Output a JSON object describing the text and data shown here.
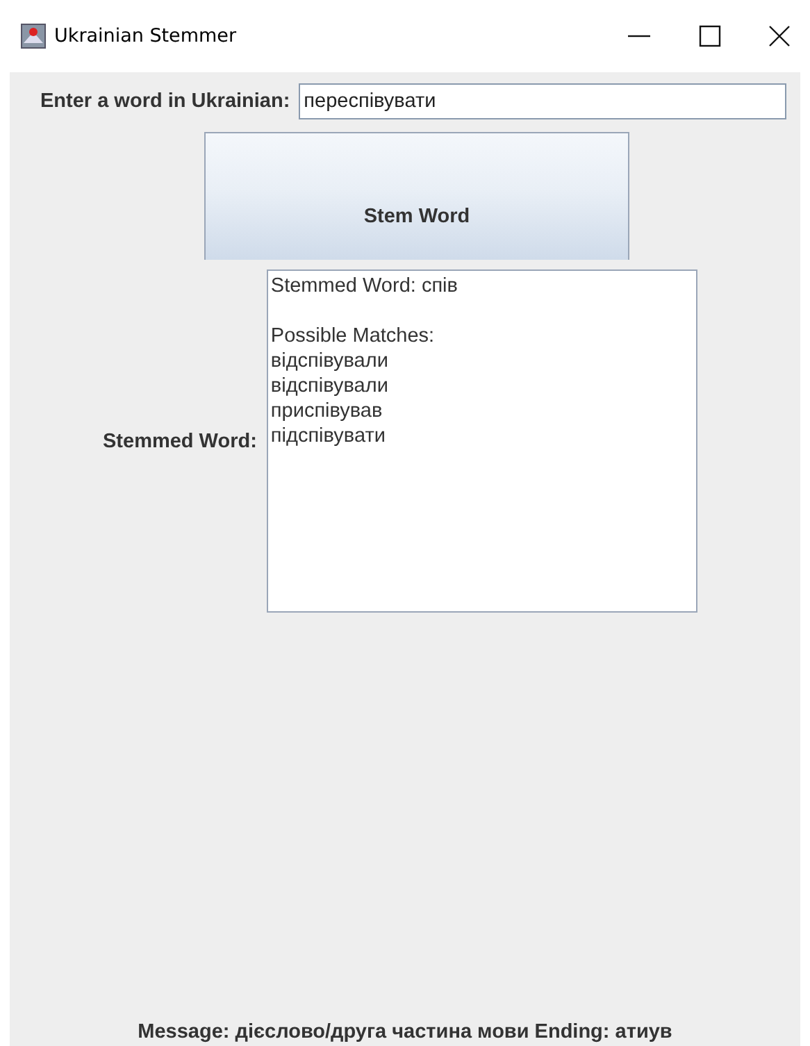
{
  "window": {
    "title": "Ukrainian Stemmer"
  },
  "input": {
    "label": "Enter a word in Ukrainian:",
    "value": "переспівувати"
  },
  "button": {
    "label": "Stem Word"
  },
  "result": {
    "label": "Stemmed Word:",
    "stem": "Stemmed Word: спів",
    "matches_heading": "Possible Matches:",
    "matches": [
      "відспівували",
      "відспівували",
      "приспівував",
      "підспівувати"
    ]
  },
  "message": "Message: дієслово/друга частина мови Ending: атиув"
}
